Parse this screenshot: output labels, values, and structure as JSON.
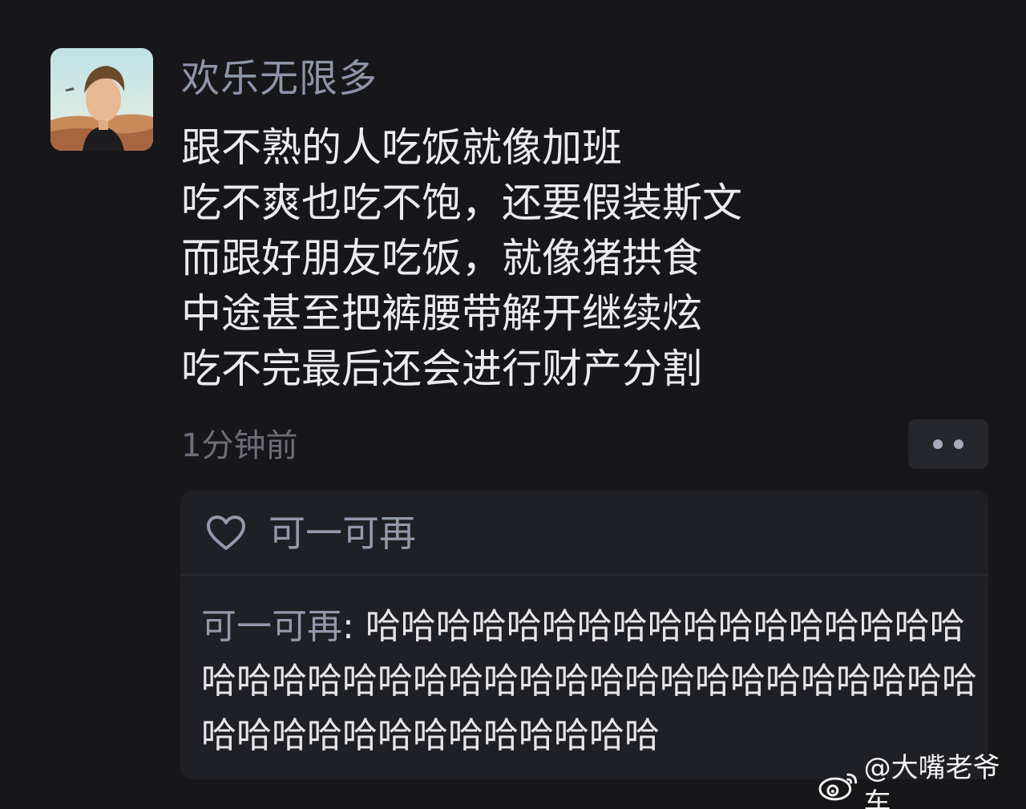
{
  "post": {
    "username": "欢乐无限多",
    "lines": [
      "跟不熟的人吃饭就像加班",
      "吃不爽也吃不饱，还要假装斯文",
      "而跟好朋友吃饭，就像猪拱食",
      "中途甚至把裤腰带解开继续炫",
      "吃不完最后还会进行财产分割"
    ],
    "timestamp": "1分钟前",
    "more_icon": "more-dots-icon"
  },
  "likes": {
    "icon": "heart-outline-icon",
    "liker": "可一可再"
  },
  "comment": {
    "author": "可一可再",
    "separator": ": ",
    "text": "哈哈哈哈哈哈哈哈哈哈哈哈哈哈哈哈哈哈哈哈哈哈哈哈哈哈哈哈哈哈哈哈哈哈哈哈哈哈哈哈哈哈哈哈哈哈哈哈哈哈哈哈"
  },
  "watermark": {
    "icon": "weibo-icon",
    "text": "@大嘴老爷车"
  },
  "colors": {
    "background": "#17171a",
    "username": "#8f94a8",
    "text": "#ececf0",
    "timestamp": "#6c6e78",
    "card": "#1f2025"
  }
}
